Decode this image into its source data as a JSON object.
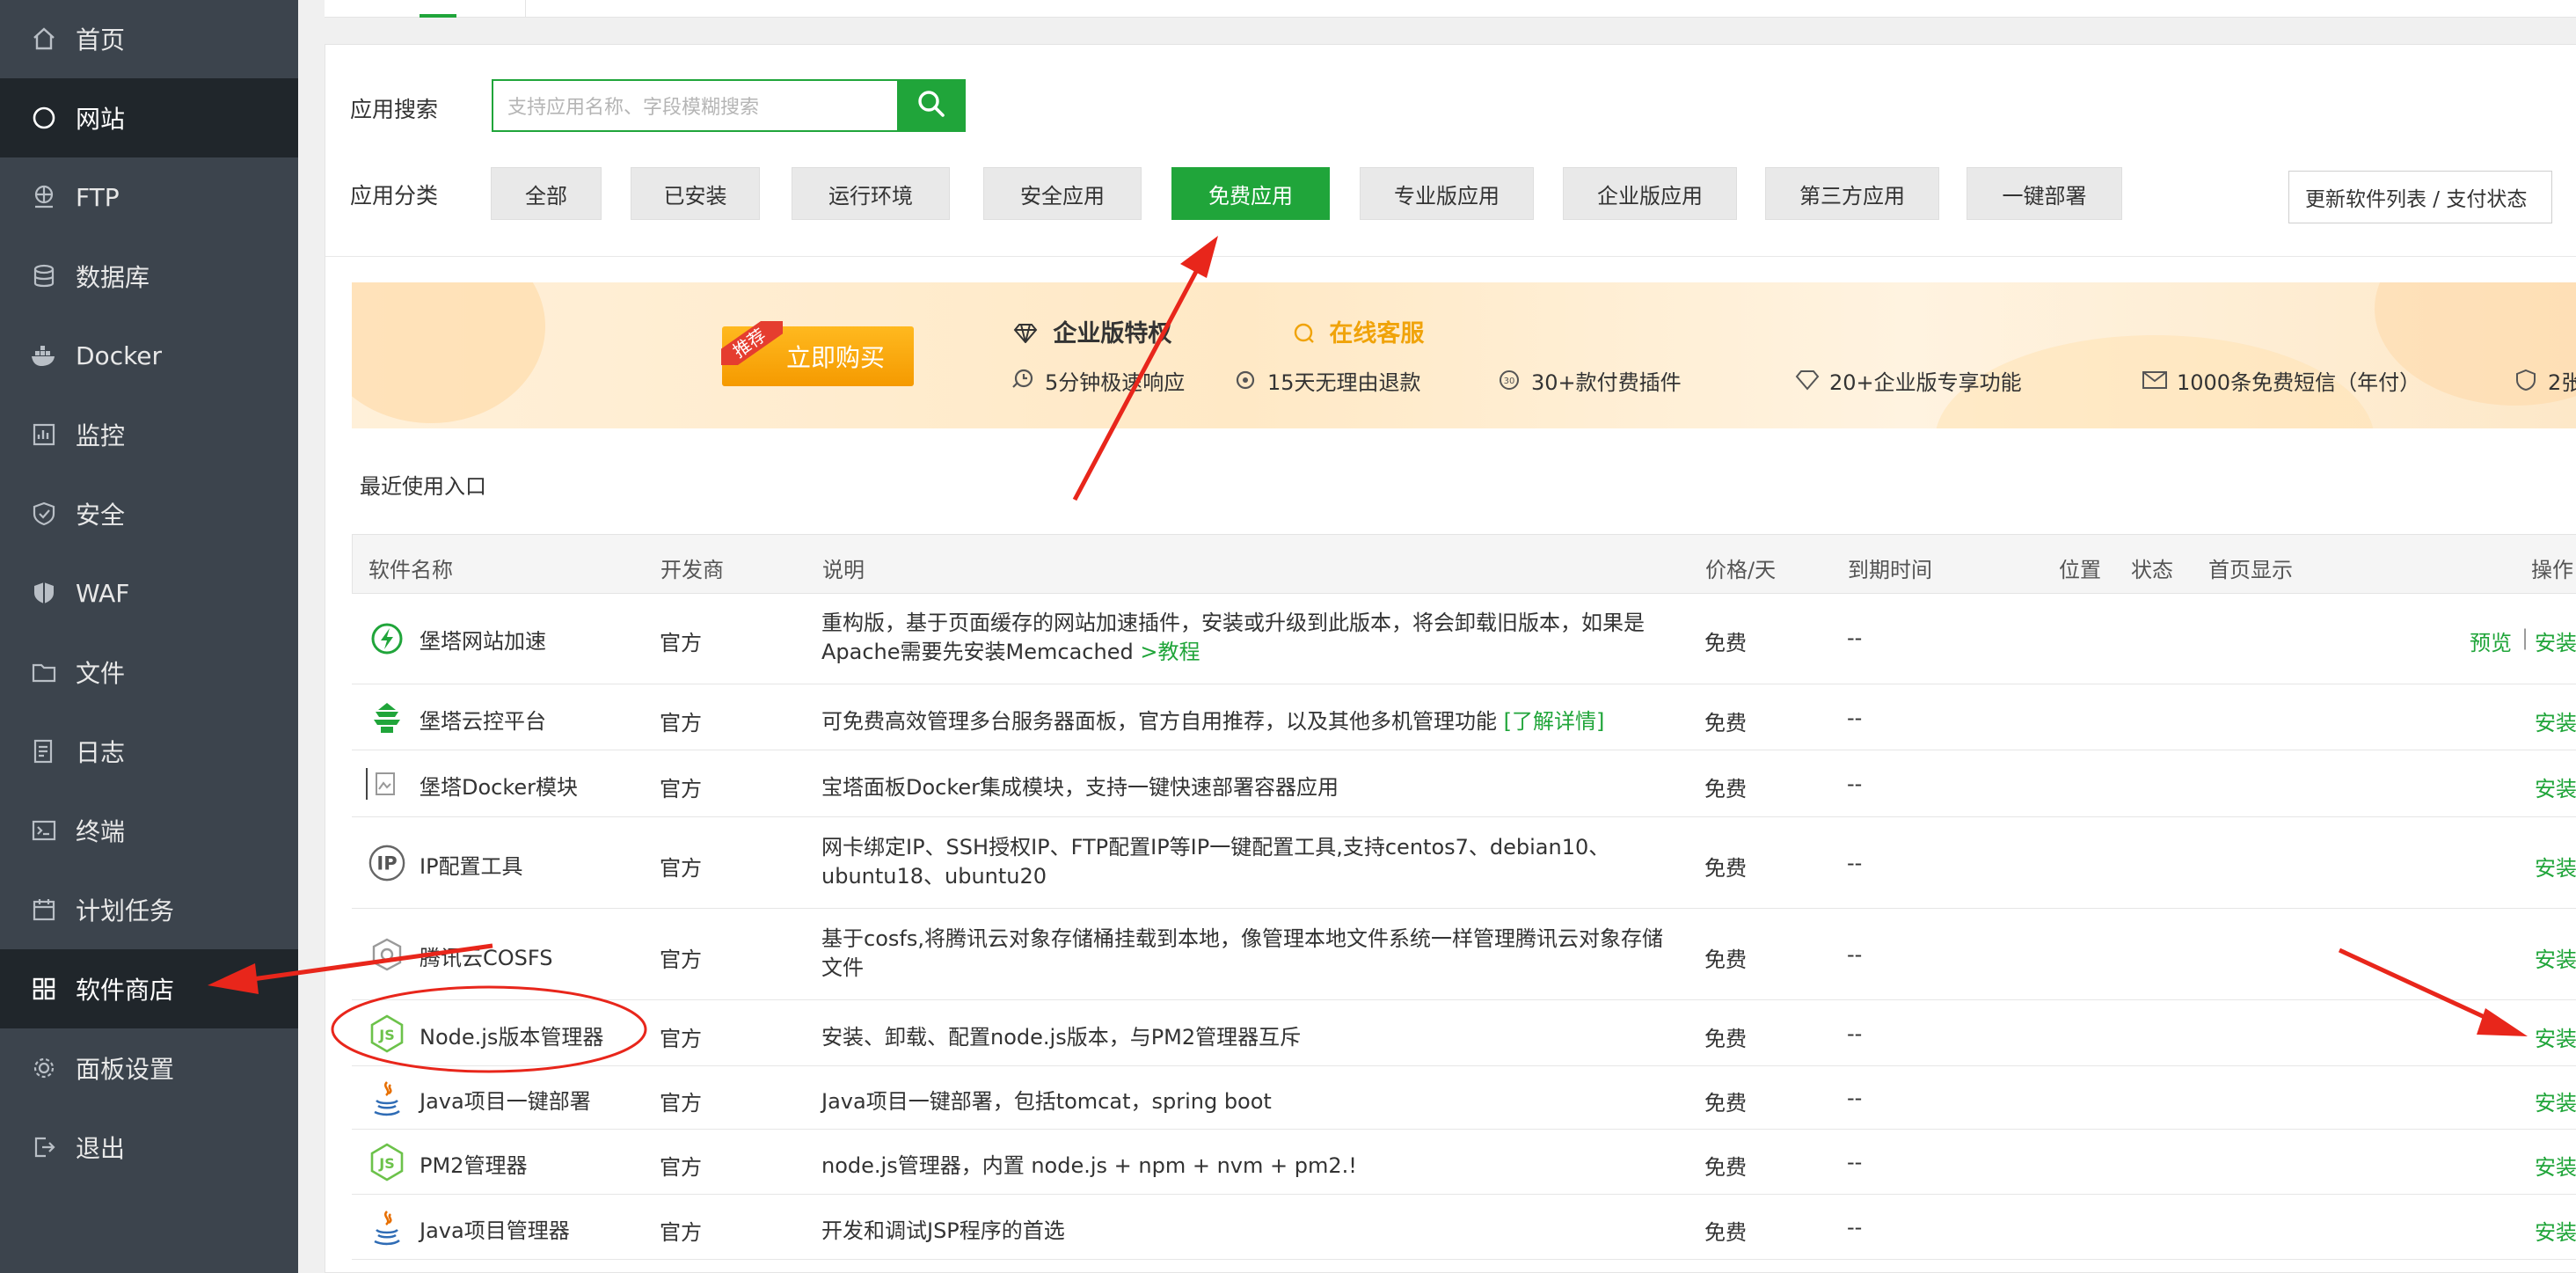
{
  "sidebar": {
    "items": [
      {
        "label": "首页",
        "icon": "home-icon"
      },
      {
        "label": "网站",
        "icon": "globe-icon"
      },
      {
        "label": "FTP",
        "icon": "ftp-icon"
      },
      {
        "label": "数据库",
        "icon": "database-icon"
      },
      {
        "label": "Docker",
        "icon": "docker-icon"
      },
      {
        "label": "监控",
        "icon": "monitor-icon"
      },
      {
        "label": "安全",
        "icon": "shield-icon"
      },
      {
        "label": "WAF",
        "icon": "waf-shield-icon"
      },
      {
        "label": "文件",
        "icon": "folder-icon"
      },
      {
        "label": "日志",
        "icon": "log-icon"
      },
      {
        "label": "终端",
        "icon": "terminal-icon"
      },
      {
        "label": "计划任务",
        "icon": "calendar-icon"
      },
      {
        "label": "软件商店",
        "icon": "grid-icon"
      },
      {
        "label": "面板设置",
        "icon": "gear-icon"
      },
      {
        "label": "退出",
        "icon": "logout-icon"
      }
    ],
    "active_index": 12
  },
  "search": {
    "label": "应用搜索",
    "placeholder": "支持应用名称、字段模糊搜索"
  },
  "categories": {
    "label": "应用分类",
    "items": [
      "全部",
      "已安装",
      "运行环境",
      "安全应用",
      "免费应用",
      "专业版应用",
      "企业版应用",
      "第三方应用",
      "一键部署"
    ],
    "active": "免费应用",
    "update_button": "更新软件列表 / 支付状态"
  },
  "banner": {
    "ribbon": "推荐",
    "buy": "立即购买",
    "title": "企业版特权",
    "service": "在线客服",
    "features": [
      "5分钟极速响应",
      "15天无理由退款",
      "30+款付费插件",
      "20+企业版专享功能",
      "1000条免费短信（年付）",
      "2张"
    ]
  },
  "recent_label": "最近使用入口",
  "table": {
    "headers": {
      "name": "软件名称",
      "vendor": "开发商",
      "desc": "说明",
      "price": "价格/天",
      "expire": "到期时间",
      "position": "位置",
      "status": "状态",
      "home": "首页显示",
      "ops": "操作"
    },
    "rows": [
      {
        "name": "堡塔网站加速",
        "vendor": "官方",
        "desc": "重构版，基于页面缓存的网站加速插件，安装或升级到此版本，将会卸载旧版本，如果是Apache需要先安装Memcached",
        "link": ">教程",
        "price": "免费",
        "expire": "--",
        "preview": "预览",
        "sep": "|",
        "action": "安装",
        "icon": "lightning-icon"
      },
      {
        "name": "堡塔云控平台",
        "vendor": "官方",
        "desc": "可免费高效管理多台服务器面板，官方自用推荐，以及其他多机管理功能",
        "link": "[了解详情]",
        "price": "免费",
        "expire": "--",
        "action": "安装",
        "icon": "pagoda-icon"
      },
      {
        "name": "堡塔Docker模块",
        "vendor": "官方",
        "desc": "宝塔面板Docker集成模块，支持一键快速部署容器应用",
        "price": "免费",
        "expire": "--",
        "action": "安装",
        "icon": "image-icon"
      },
      {
        "name": "IP配置工具",
        "vendor": "官方",
        "desc": "网卡绑定IP、SSH授权IP、FTP配置IP等IP一键配置工具,支持centos7、debian10、ubuntu18、ubuntu20",
        "price": "免费",
        "expire": "--",
        "action": "安装",
        "icon": "ip-icon"
      },
      {
        "name": "腾讯云COSFS",
        "vendor": "官方",
        "desc": "基于cosfs,将腾讯云对象存储桶挂载到本地，像管理本地文件系统一样管理腾讯云对象存储文件",
        "price": "免费",
        "expire": "--",
        "action": "安装",
        "icon": "cosfs-icon"
      },
      {
        "name": "Node.js版本管理器",
        "vendor": "官方",
        "desc": "安装、卸载、配置node.js版本，与PM2管理器互斥",
        "price": "免费",
        "expire": "--",
        "action": "安装",
        "icon": "nodejs-icon"
      },
      {
        "name": "Java项目一键部署",
        "vendor": "官方",
        "desc": "Java项目一键部署，包括tomcat，spring boot",
        "price": "免费",
        "expire": "--",
        "action": "安装",
        "icon": "java-icon"
      },
      {
        "name": "PM2管理器",
        "vendor": "官方",
        "desc": "node.js管理器，内置 node.js + npm + nvm + pm2.!",
        "price": "免费",
        "expire": "--",
        "action": "安装",
        "icon": "nodejs-icon"
      },
      {
        "name": "Java项目管理器",
        "vendor": "官方",
        "desc": "开发和调试JSP程序的首选",
        "price": "免费",
        "expire": "--",
        "action": "安装",
        "icon": "java-icon"
      }
    ]
  },
  "colors": {
    "accent": "#20a53a",
    "sidebar": "#3c444d",
    "sidebar_active": "#20262b",
    "annotation": "#e8261b"
  }
}
